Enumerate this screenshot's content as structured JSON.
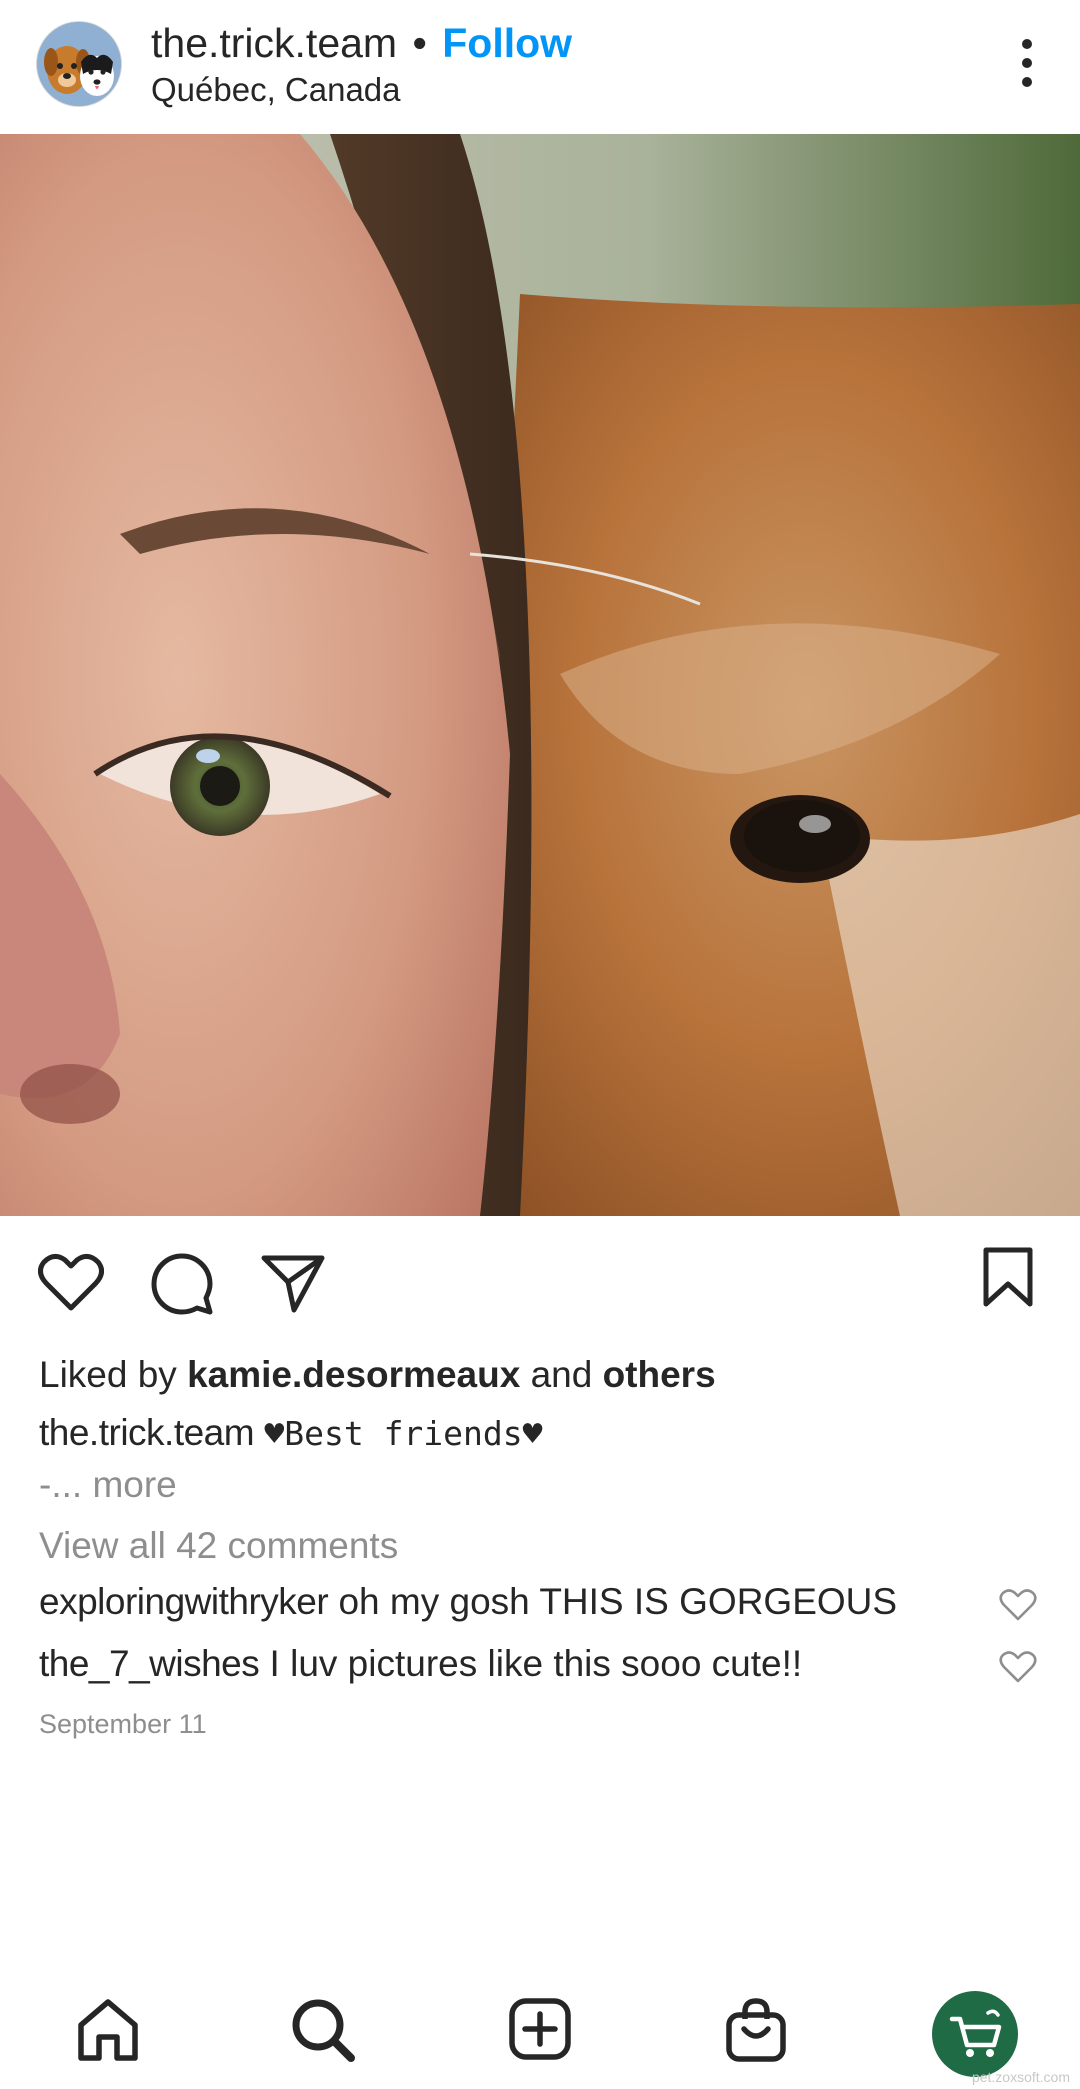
{
  "header": {
    "username": "the.trick.team",
    "separator": "•",
    "follow_label": "Follow",
    "location": "Québec, Canada",
    "avatar_icon": "dogs-avatar-icon",
    "menu_icon": "more-vertical-icon"
  },
  "photo": {
    "icon": "post-photo"
  },
  "actions": {
    "like_icon": "heart-icon",
    "comment_icon": "comment-icon",
    "share_icon": "share-icon",
    "save_icon": "bookmark-icon"
  },
  "likes": {
    "prefix": "Liked by",
    "user": "kamie.desormeaux",
    "connector": "and",
    "others": "others"
  },
  "caption": {
    "username": "the.trick.team",
    "text": "♥Best friends♥",
    "continuation": "-",
    "more_label": "... more"
  },
  "view_comments_label": "View all 42 comments",
  "comments": [
    {
      "username": "exploringwithryker",
      "text": "oh my gosh THIS IS GORGEOUS"
    },
    {
      "username": "the_7_wishes",
      "text": "I luv pictures like this sooo cute!!"
    }
  ],
  "post_date": "September 11",
  "nav": {
    "items": [
      "home-icon",
      "search-icon",
      "create-icon",
      "shopping-bag-icon",
      "shop-cart-icon"
    ]
  },
  "watermark": "pet.zoxsoft.com",
  "colors": {
    "follow_blue": "#0095f6",
    "secondary_gray": "#8e8e8e",
    "shop_green": "#1f6b45",
    "text_dark": "#262626"
  }
}
